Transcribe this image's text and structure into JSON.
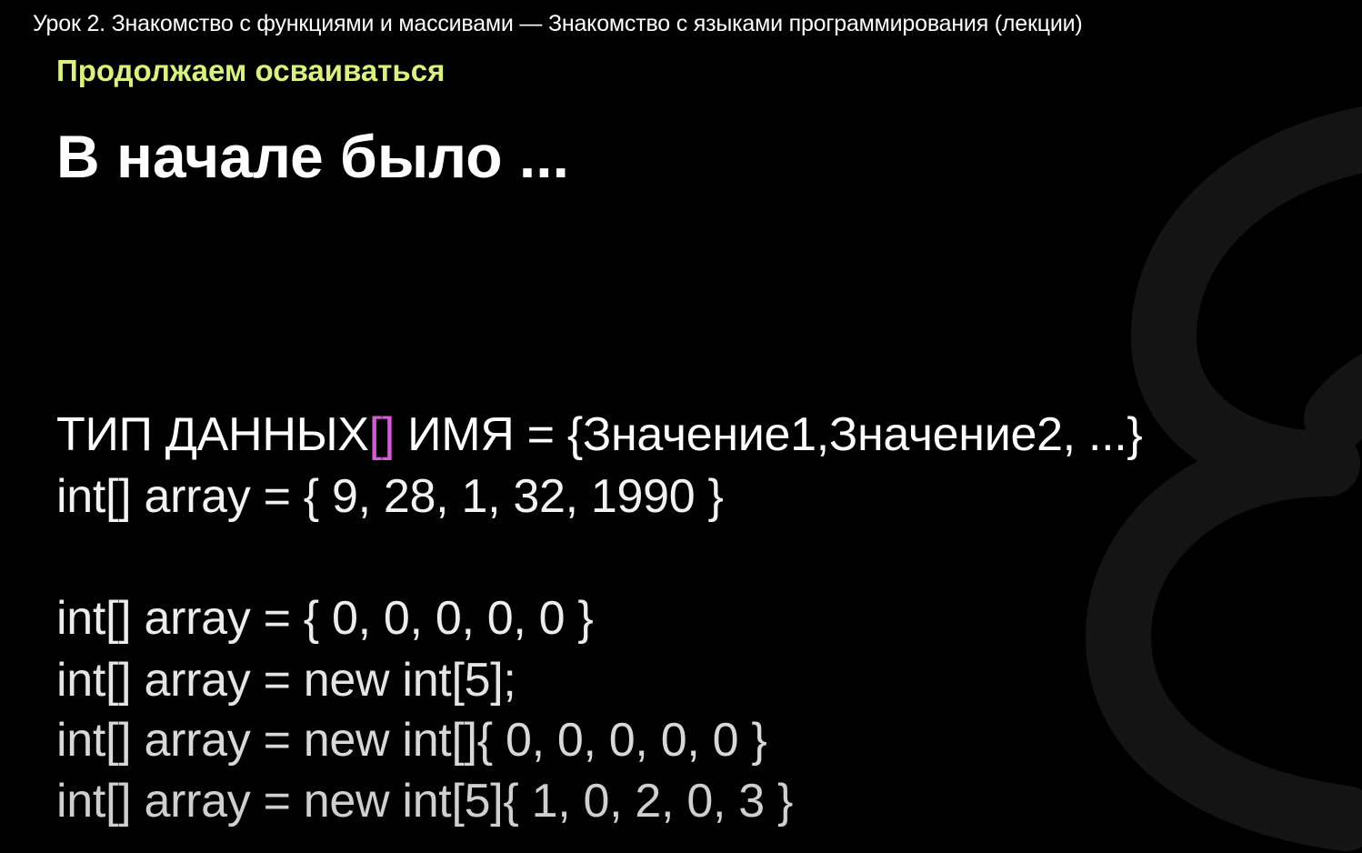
{
  "video": {
    "title": "Урок 2. Знакомство с функциями и массивами — Знакомство с языками программирования (лекции)"
  },
  "slide": {
    "subtitle": "Продолжаем осваиваться",
    "heading": "В начале было ...",
    "syntax": {
      "type": "ТИП ДАННЫХ",
      "brackets": "[]",
      "rest": " ИМЯ = {Значение1,Значение2, ...}"
    },
    "code_lines": [
      "int[] array = { 9, 28, 1, 32, 1990 }",
      "int[] array = { 0, 0, 0, 0, 0 }",
      "int[] array = new int[5];",
      "int[] array = new int[]{ 0, 0, 0, 0, 0 }",
      "int[] array = new int[5]{ 1, 0, 2, 0, 3 }"
    ]
  },
  "colors": {
    "background": "#000000",
    "subtitle": "#d9f27a",
    "bracket_accent": "#d45ad8",
    "logo": "#141414"
  },
  "icons": {
    "logo": "brand-logo-icon"
  }
}
